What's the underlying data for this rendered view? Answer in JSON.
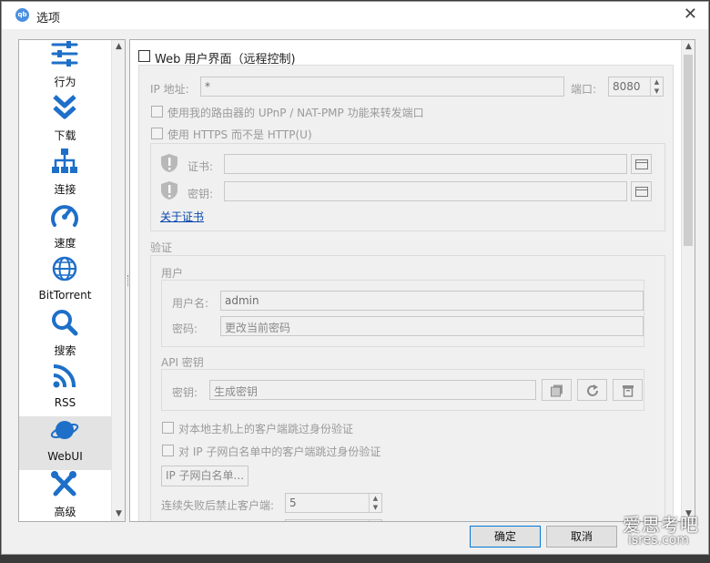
{
  "window": {
    "title": "选项",
    "app_icon": "qb"
  },
  "sidebar": {
    "items": [
      {
        "label": "行为",
        "icon": "sliders-icon"
      },
      {
        "label": "下载",
        "icon": "double-chevron-down-icon"
      },
      {
        "label": "连接",
        "icon": "network-icon"
      },
      {
        "label": "速度",
        "icon": "speedometer-icon"
      },
      {
        "label": "BitTorrent",
        "icon": "globe-icon"
      },
      {
        "label": "搜索",
        "icon": "search-icon"
      },
      {
        "label": "RSS",
        "icon": "rss-icon"
      },
      {
        "label": "WebUI",
        "icon": "planet-icon",
        "selected": true
      },
      {
        "label": "高级",
        "icon": "tools-icon"
      }
    ]
  },
  "webui": {
    "enable_label": "Web 用户界面（远程控制)",
    "ip_label": "IP 地址:",
    "ip_value": "*",
    "port_label": "端口:",
    "port_value": "8080",
    "upnp_label": "使用我的路由器的 UPnP / NAT-PMP 功能来转发端口",
    "https_label": "使用 HTTPS 而不是 HTTP(U)",
    "cert_label": "证书:",
    "key_label": "密钥:",
    "about_cert_link": "关于证书"
  },
  "auth": {
    "section_title": "验证",
    "user_group_title": "用户",
    "username_label": "用户名:",
    "username_value": "admin",
    "password_label": "密码:",
    "password_placeholder": "更改当前密码",
    "api_group_title": "API 密钥",
    "api_key_label": "密钥:",
    "api_key_placeholder": "生成密钥",
    "bypass_localhost_label": "对本地主机上的客户端跳过身份验证",
    "bypass_whitelist_label": "对 IP 子网白名单中的客户端跳过身份验证",
    "whitelist_button": "IP 子网白名单...",
    "ban_after_label": "连续失败后禁止客户端:",
    "ban_after_value": "5"
  },
  "footer": {
    "ok_label": "确定",
    "cancel_label": "取消"
  },
  "watermark": {
    "line1": "爱思考吧",
    "line2": "isres.com"
  }
}
